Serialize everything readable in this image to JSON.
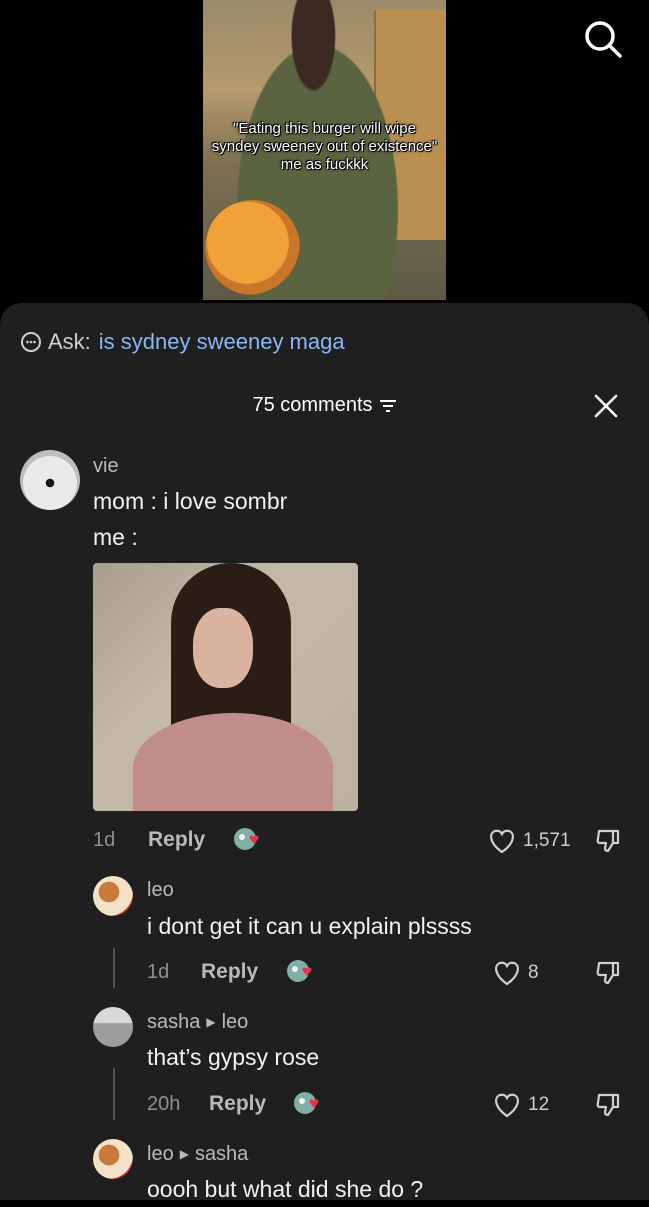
{
  "video": {
    "caption": "\"Eating this burger will wipe syndey sweeney out of existence\" me as fuckkk"
  },
  "ask": {
    "label": "Ask:",
    "query": "is sydney sweeney maga"
  },
  "comments_header": {
    "count_label": "75 comments"
  },
  "comments": [
    {
      "username": "vie",
      "lines": [
        "mom : i love sombr",
        "me :"
      ],
      "age": "1d",
      "reply_label": "Reply",
      "likes": "1,571"
    },
    {
      "username": "leo",
      "text": "i dont get it can u explain plssss",
      "age": "1d",
      "reply_label": "Reply",
      "likes": "8"
    },
    {
      "username": "sasha",
      "reply_to": "leo",
      "text": "that’s gypsy rose",
      "age": "20h",
      "reply_label": "Reply",
      "likes": "12"
    },
    {
      "username": "leo",
      "reply_to": "sasha",
      "text": "oooh but what did she do ?"
    }
  ],
  "icons": {
    "search": "search-icon",
    "filter": "filter-icon",
    "close": "close-icon",
    "heart": "heart-icon",
    "dislike": "thumbs-down-icon",
    "ask": "ask-bubble-icon"
  },
  "colors": {
    "sheet_bg": "#1f1f1f",
    "link_blue": "#8ab6f5",
    "reaction_heart": "#e8334a"
  }
}
